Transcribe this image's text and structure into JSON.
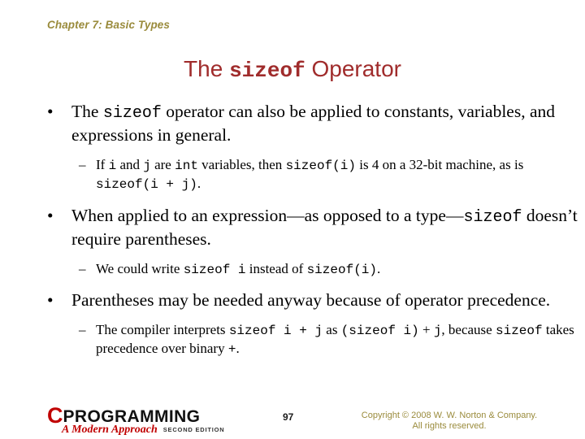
{
  "slide": {
    "chapter_header": "Chapter 7: Basic Types",
    "title": {
      "before": "The ",
      "mono": "sizeof",
      "after": " Operator"
    },
    "bullet_char": "•",
    "dash_char": "–",
    "bullets": [
      {
        "level": 1,
        "parts": [
          {
            "text": "The ",
            "mono": false
          },
          {
            "text": "sizeof",
            "mono": true
          },
          {
            "text": " operator can also be applied to constants, variables, and expressions in general.",
            "mono": false
          }
        ]
      },
      {
        "level": 2,
        "parts": [
          {
            "text": "If ",
            "mono": false
          },
          {
            "text": "i",
            "mono": true
          },
          {
            "text": " and ",
            "mono": false
          },
          {
            "text": "j",
            "mono": true
          },
          {
            "text": " are ",
            "mono": false
          },
          {
            "text": "int",
            "mono": true
          },
          {
            "text": " variables, then ",
            "mono": false
          },
          {
            "text": "sizeof(i)",
            "mono": true
          },
          {
            "text": " is 4 on a 32-bit machine, as is ",
            "mono": false
          },
          {
            "text": "sizeof(i + j)",
            "mono": true
          },
          {
            "text": ".",
            "mono": false
          }
        ]
      },
      {
        "level": 1,
        "parts": [
          {
            "text": "When applied to an expression—as opposed to a type—",
            "mono": false
          },
          {
            "text": "sizeof",
            "mono": true
          },
          {
            "text": " doesn’t require parentheses.",
            "mono": false
          }
        ]
      },
      {
        "level": 2,
        "parts": [
          {
            "text": "We could write ",
            "mono": false
          },
          {
            "text": "sizeof i",
            "mono": true
          },
          {
            "text": " instead of ",
            "mono": false
          },
          {
            "text": "sizeof(i)",
            "mono": true
          },
          {
            "text": ".",
            "mono": false
          }
        ]
      },
      {
        "level": 1,
        "parts": [
          {
            "text": "Parentheses may be needed anyway because of operator precedence.",
            "mono": false
          }
        ]
      },
      {
        "level": 2,
        "parts": [
          {
            "text": "The compiler interprets ",
            "mono": false
          },
          {
            "text": "sizeof i + j",
            "mono": true
          },
          {
            "text": " as ",
            "mono": false
          },
          {
            "text": "(sizeof i)",
            "mono": true
          },
          {
            "text": " + ",
            "mono": false
          },
          {
            "text": "j",
            "mono": true
          },
          {
            "text": ", because ",
            "mono": false
          },
          {
            "text": "sizeof",
            "mono": true
          },
          {
            "text": " takes precedence over binary ",
            "mono": false
          },
          {
            "text": "+",
            "mono": true
          },
          {
            "text": ".",
            "mono": false
          }
        ]
      }
    ]
  },
  "footer": {
    "logo": {
      "letter_c": "C",
      "wordmark": "PROGRAMMING",
      "subtitle": "A Modern Approach",
      "edition": "SECOND EDITION"
    },
    "page_number": "97",
    "copyright_line1": "Copyright © 2008 W. W. Norton & Company.",
    "copyright_line2": "All rights reserved."
  },
  "colors": {
    "accent_red": "#a02c2c",
    "header_olive": "#9a8b3c",
    "logo_red": "#c00000",
    "background": "#ffffff",
    "body_text": "#000000"
  }
}
